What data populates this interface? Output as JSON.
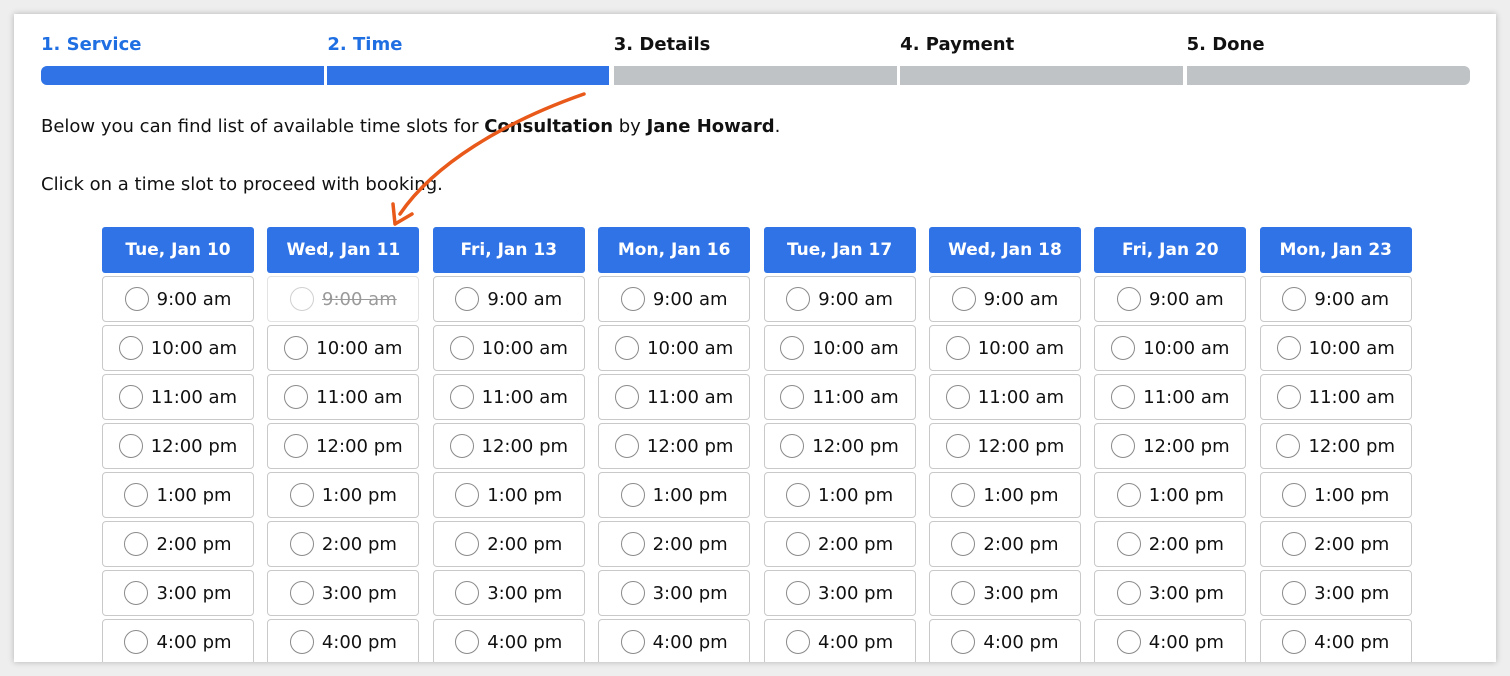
{
  "steps": [
    {
      "label": "1. Service",
      "state": "active"
    },
    {
      "label": "2. Time",
      "state": "active"
    },
    {
      "label": "3. Details",
      "state": "inactive"
    },
    {
      "label": "4. Payment",
      "state": "inactive"
    },
    {
      "label": "5. Done",
      "state": "inactive"
    }
  ],
  "intro": {
    "prefix": "Below you can find list of available time slots for ",
    "service": "Consultation",
    "by": " by ",
    "staff": "Jane Howard",
    "suffix": "."
  },
  "hint": "Click on a time slot to proceed with booking.",
  "days": [
    {
      "label": "Tue, Jan 10",
      "disabled_slots": []
    },
    {
      "label": "Wed, Jan 11",
      "disabled_slots": [
        "9:00 am"
      ]
    },
    {
      "label": "Fri, Jan 13",
      "disabled_slots": []
    },
    {
      "label": "Mon, Jan 16",
      "disabled_slots": []
    },
    {
      "label": "Tue, Jan 17",
      "disabled_slots": []
    },
    {
      "label": "Wed, Jan 18",
      "disabled_slots": []
    },
    {
      "label": "Fri, Jan 20",
      "disabled_slots": []
    },
    {
      "label": "Mon, Jan 23",
      "disabled_slots": []
    }
  ],
  "slots": [
    "9:00 am",
    "10:00 am",
    "11:00 am",
    "12:00 pm",
    "1:00 pm",
    "2:00 pm",
    "3:00 pm",
    "4:00 pm"
  ],
  "colors": {
    "accent": "#2f73e6",
    "step_inactive": "#bfc3c6",
    "annotation_arrow": "#e8591a"
  }
}
